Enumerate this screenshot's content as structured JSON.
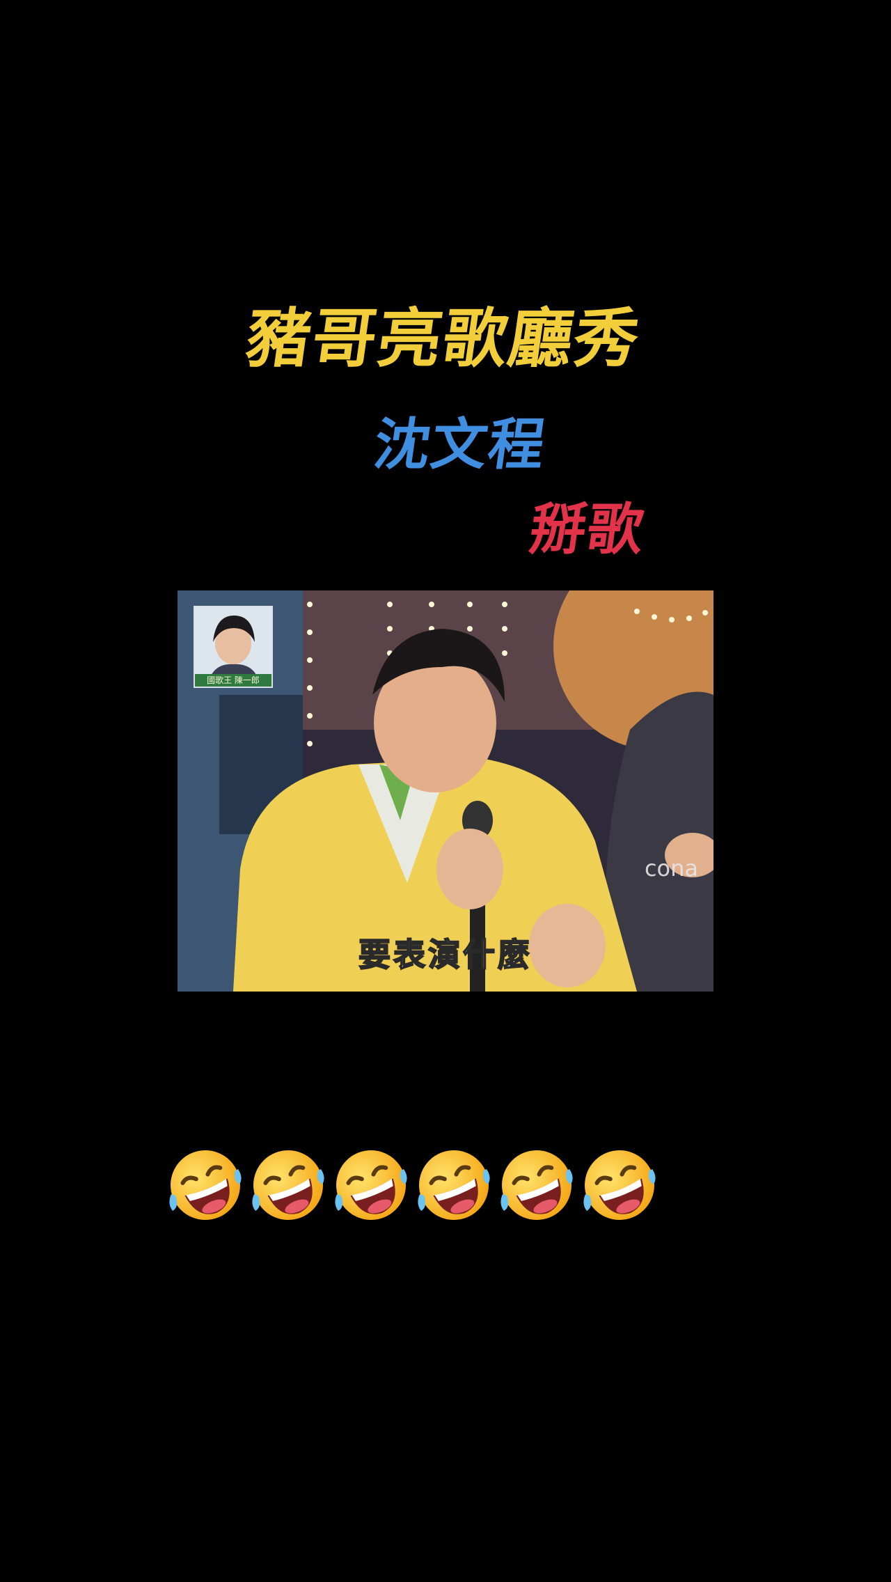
{
  "captions": {
    "title": "豬哥亮歌廳秀",
    "name": "沈文程",
    "tag": "掰歌"
  },
  "video": {
    "thumbnail_label": "國歌王 陳一郎",
    "watermark": "cona",
    "subtitle": "要表演什麼"
  },
  "emoji_row": [
    "rolling-on-floor-laughing-icon",
    "rolling-on-floor-laughing-icon",
    "rolling-on-floor-laughing-icon",
    "rolling-on-floor-laughing-icon",
    "rolling-on-floor-laughing-icon",
    "rolling-on-floor-laughing-icon"
  ],
  "colors": {
    "background": "#000000",
    "title": "#f2cf3a",
    "name": "#3f8ee0",
    "tag": "#e2334a"
  }
}
